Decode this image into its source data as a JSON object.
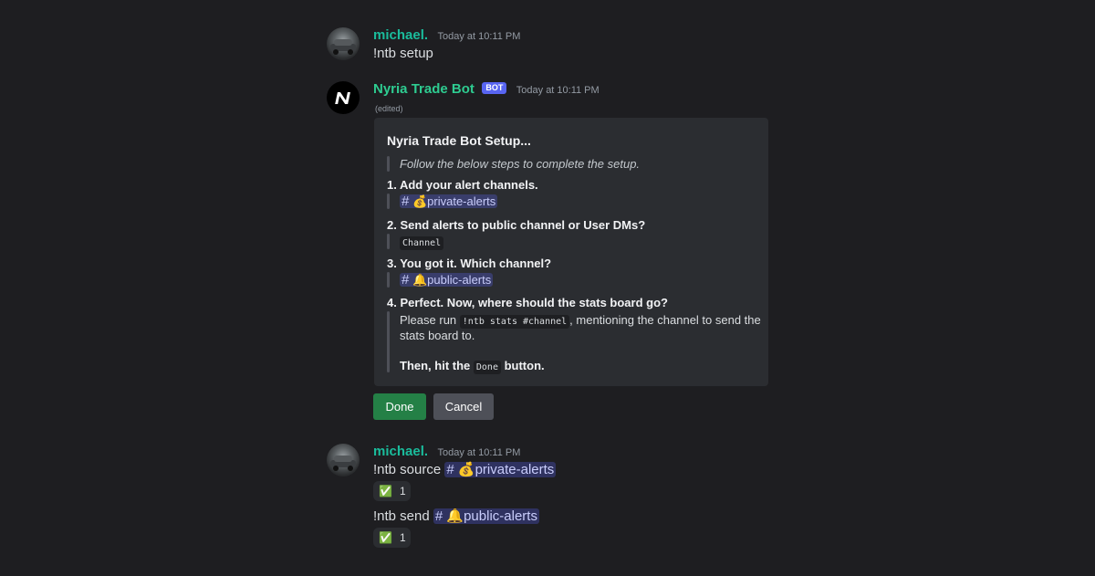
{
  "messages": [
    {
      "username": "michael.",
      "timestamp": "Today at 10:11 PM",
      "text": "!ntb setup"
    },
    {
      "username": "Nyria Trade Bot",
      "bot_tag": "BOT",
      "timestamp": "Today at 10:11 PM",
      "edited": "(edited)",
      "embed": {
        "title": "Nyria Trade Bot Setup...",
        "intro": "Follow the below steps to complete the setup.",
        "step1": {
          "title": "1. Add your alert channels.",
          "channel": "private-alerts",
          "emoji": "💰"
        },
        "step2": {
          "title": "2. Send alerts to public channel or User DMs?",
          "answer": "Channel"
        },
        "step3": {
          "title": "3. You got it. Which channel?",
          "channel": "public-alerts",
          "emoji": "🔔"
        },
        "step4": {
          "title": "4. Perfect. Now, where should the stats board go?",
          "line1_pre": "Please run ",
          "line1_code": "!ntb stats #channel",
          "line1_post": ", mentioning the channel to send the",
          "line2": "stats board to.",
          "final_pre": "Then, hit the ",
          "final_code": "Done",
          "final_post": " button."
        }
      },
      "buttons": {
        "done": "Done",
        "cancel": "Cancel"
      }
    },
    {
      "username": "michael.",
      "timestamp": "Today at 10:11 PM",
      "line1": {
        "command": "!ntb source ",
        "channel": "private-alerts",
        "emoji": "💰"
      },
      "reaction1": {
        "emoji": "✅",
        "count": "1"
      },
      "line2": {
        "command": "!ntb send ",
        "channel": "public-alerts",
        "emoji": "🔔"
      },
      "reaction2": {
        "emoji": "✅",
        "count": "1"
      }
    }
  ],
  "colors": {
    "background": "#1e1e21",
    "username": "#1abc9c",
    "embed_bg": "#2b2d31",
    "mention_bg": "#3c4270",
    "done_button": "#248046",
    "cancel_button": "#4e5058",
    "bot_tag": "#5865f2"
  },
  "icons": {
    "channel": "hash-icon",
    "bot_logo": "nyria-logo-icon",
    "money_bag": "money-bag-icon",
    "bell": "bell-icon",
    "check": "check-icon"
  }
}
